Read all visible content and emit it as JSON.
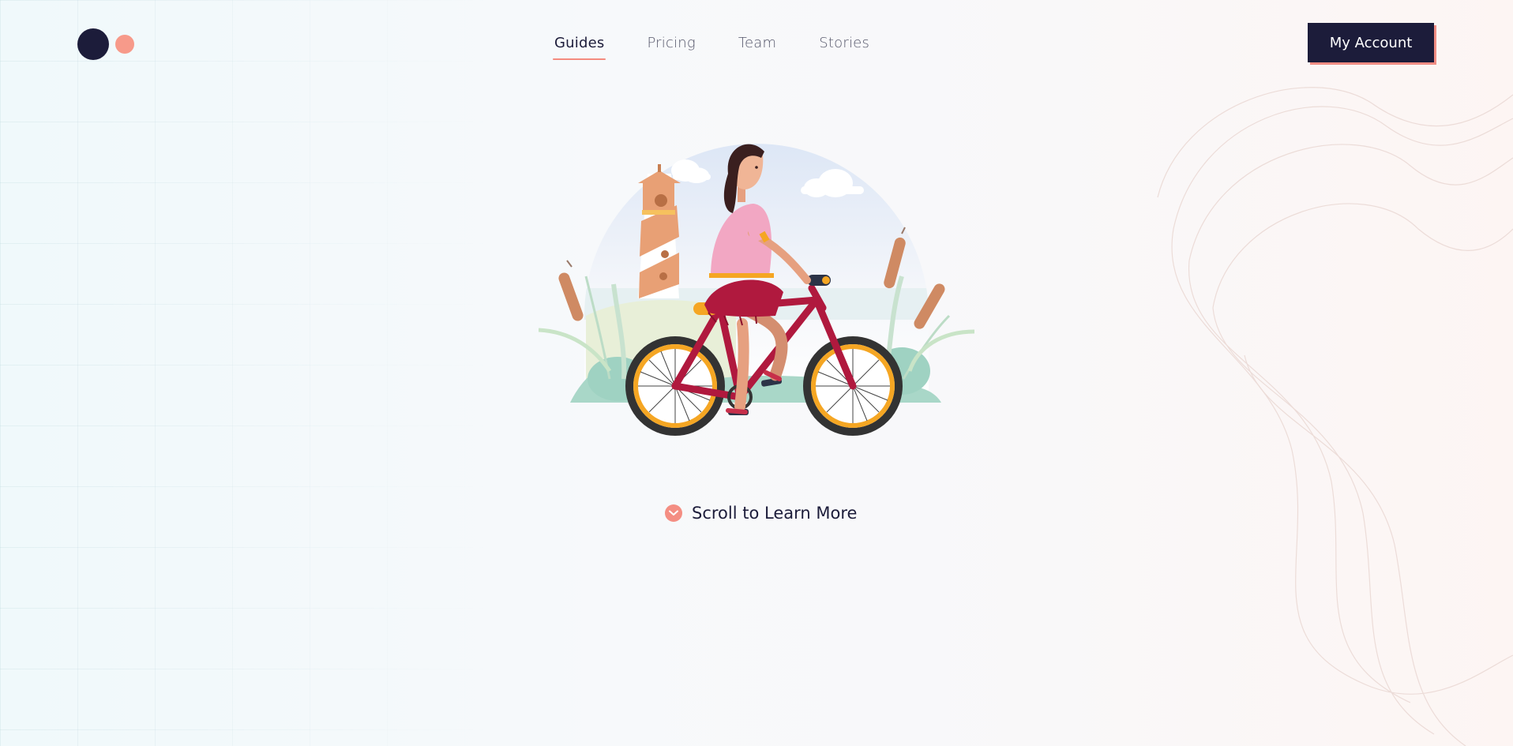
{
  "nav": {
    "items": [
      {
        "label": "Guides",
        "active": true
      },
      {
        "label": "Pricing",
        "active": false
      },
      {
        "label": "Team",
        "active": false
      },
      {
        "label": "Stories",
        "active": false
      }
    ]
  },
  "header": {
    "account_label": "My Account"
  },
  "hero": {
    "scroll_label": "Scroll to Learn More"
  },
  "icons": {
    "scroll": "chevron-down-icon",
    "logo": "logo-dots"
  },
  "colors": {
    "navy": "#1c1c3a",
    "coral": "#f48e83",
    "bike_frame": "#b0193e",
    "wheel_rim": "#f5a623",
    "sky": "#dfe8f6"
  }
}
